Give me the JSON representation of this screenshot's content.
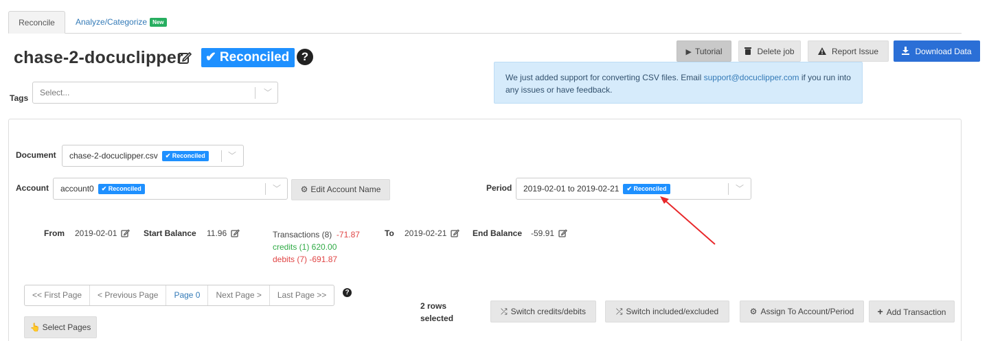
{
  "tabs": [
    {
      "label": "Reconcile",
      "active": true
    },
    {
      "label": "Analyze/Categorize",
      "badge": "New"
    }
  ],
  "header": {
    "title": "chase-2-docuclipper",
    "status_badge": "Reconciled",
    "help": "?"
  },
  "toolbar": {
    "tutorial": "Tutorial",
    "delete": "Delete job",
    "report": "Report Issue",
    "download": "Download Data"
  },
  "alert": {
    "text_before": "We just added support for converting CSV files. Email ",
    "email": "support@docuclipper.com",
    "text_after": " if you run into any issues or have feedback."
  },
  "tags": {
    "label": "Tags",
    "placeholder": "Select..."
  },
  "document": {
    "label": "Document",
    "value": "chase-2-docuclipper.csv",
    "badge": "Reconciled"
  },
  "account": {
    "label": "Account",
    "value": "account0",
    "badge": "Reconciled",
    "edit_button": "Edit Account Name"
  },
  "period": {
    "label": "Period",
    "value": "2019-02-01 to 2019-02-21",
    "badge": "Reconciled"
  },
  "summary": {
    "from_label": "From",
    "from_value": "2019-02-01",
    "start_balance_label": "Start Balance",
    "start_balance_value": "11.96",
    "transactions_label": "Transactions (8)",
    "transactions_value": "-71.87",
    "credits": "credits (1) 620.00",
    "debits": "debits (7) -691.87",
    "to_label": "To",
    "to_value": "2019-02-21",
    "end_balance_label": "End Balance",
    "end_balance_value": "-59.91"
  },
  "pagination": {
    "first": "<< First Page",
    "previous": "< Previous Page",
    "current": "Page 0",
    "next": "Next Page >",
    "last": "Last Page >>"
  },
  "selection": {
    "line1": "2 rows",
    "line2": "selected"
  },
  "actions": {
    "switch_credits_debits": "Switch credits/debits",
    "switch_included_excluded": "Switch included/excluded",
    "assign": "Assign To Account/Period",
    "add_transaction": "Add Transaction",
    "select_pages": "Select Pages"
  },
  "colors": {
    "reconciled_badge": "#1e90ff",
    "download_button": "#2b6fd6",
    "alert_bg": "#d6ebfb",
    "credit_green": "#2eaa44",
    "debit_red": "#e04444",
    "annotation_arrow": "#e8272a",
    "new_badge": "#27ae60"
  }
}
